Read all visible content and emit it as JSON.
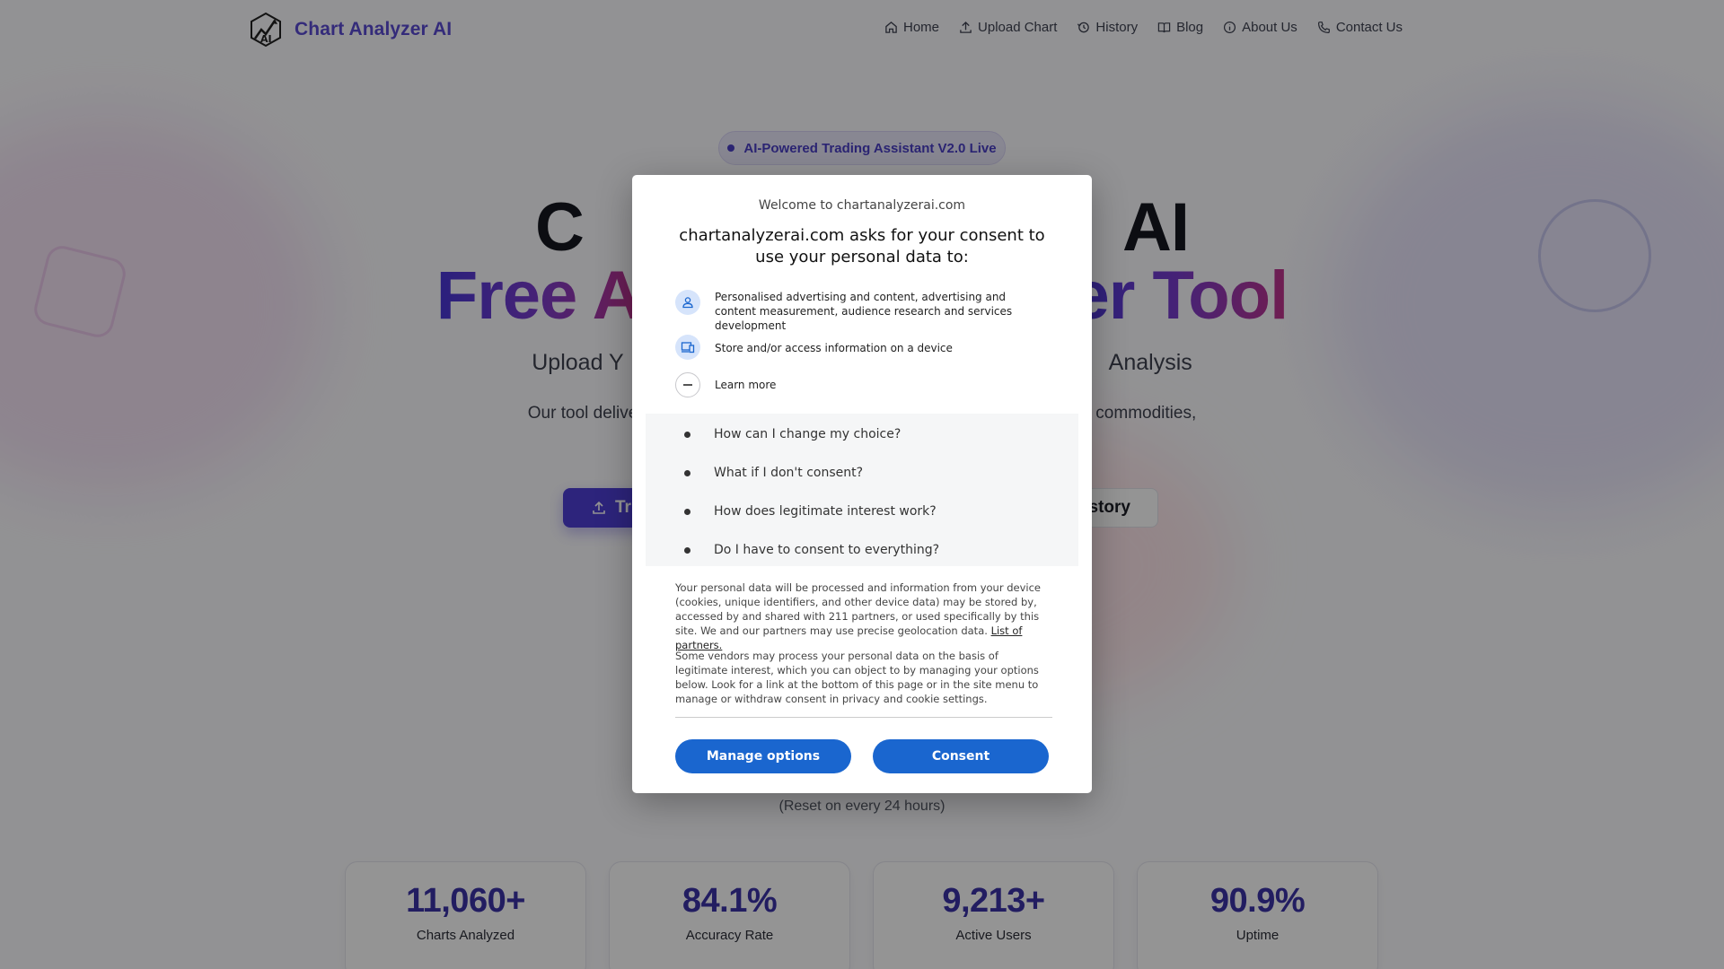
{
  "brand": {
    "name": "Chart Analyzer AI"
  },
  "nav": {
    "items": [
      {
        "label": "Home",
        "icon": "home-icon"
      },
      {
        "label": "Upload Chart",
        "icon": "upload-icon"
      },
      {
        "label": "History",
        "icon": "history-icon"
      },
      {
        "label": "Blog",
        "icon": "book-icon"
      },
      {
        "label": "About Us",
        "icon": "info-icon"
      },
      {
        "label": "Contact Us",
        "icon": "phone-icon"
      }
    ]
  },
  "hero": {
    "badge": "AI-Powered Trading Assistant V2.0 Live",
    "title_line1": "C",
    "title_line1_tail": "AI",
    "title_line2_left": "Free A",
    "title_line2_right": "er Tool",
    "subtitle_left": "Upload Y",
    "subtitle_right": "Analysis",
    "desc_left": "Our tool delive",
    "desc_right": "commodities,",
    "primary_button": "Tr",
    "secondary_button": "story",
    "reset_note": "(Reset on every 24 hours)"
  },
  "stats": [
    {
      "value": "11,060+",
      "label": "Charts Analyzed"
    },
    {
      "value": "84.1%",
      "label": "Accuracy Rate"
    },
    {
      "value": "9,213+",
      "label": "Active Users"
    },
    {
      "value": "90.9%",
      "label": "Uptime"
    }
  ],
  "consent": {
    "welcome": "Welcome to chartanalyzerai.com",
    "title": "chartanalyzerai.com asks for your consent to use your personal data to:",
    "purposes": [
      {
        "text": "Personalised advertising and content, advertising and content measurement, audience research and services development",
        "icon": "person-icon"
      },
      {
        "text": "Store and/or access information on a device",
        "icon": "device-icon"
      }
    ],
    "learn_more": "Learn more",
    "faq": [
      "How can I change my choice?",
      "What if I don't consent?",
      "How does legitimate interest work?",
      "Do I have to consent to everything?"
    ],
    "paragraph1": "Your personal data will be processed and information from your device (cookies, unique identifiers, and other device data) may be stored by, accessed by and shared with 211 partners, or used specifically by this site. We and our partners may use precise geolocation data.",
    "partners_link": "List of partners.",
    "paragraph2": "Some vendors may process your personal data on the basis of legitimate interest, which you can object to by managing your options below. Look for a link at the bottom of this page or in the site menu to manage or withdraw consent in privacy and cookie settings.",
    "manage_button": "Manage options",
    "consent_button": "Consent"
  }
}
